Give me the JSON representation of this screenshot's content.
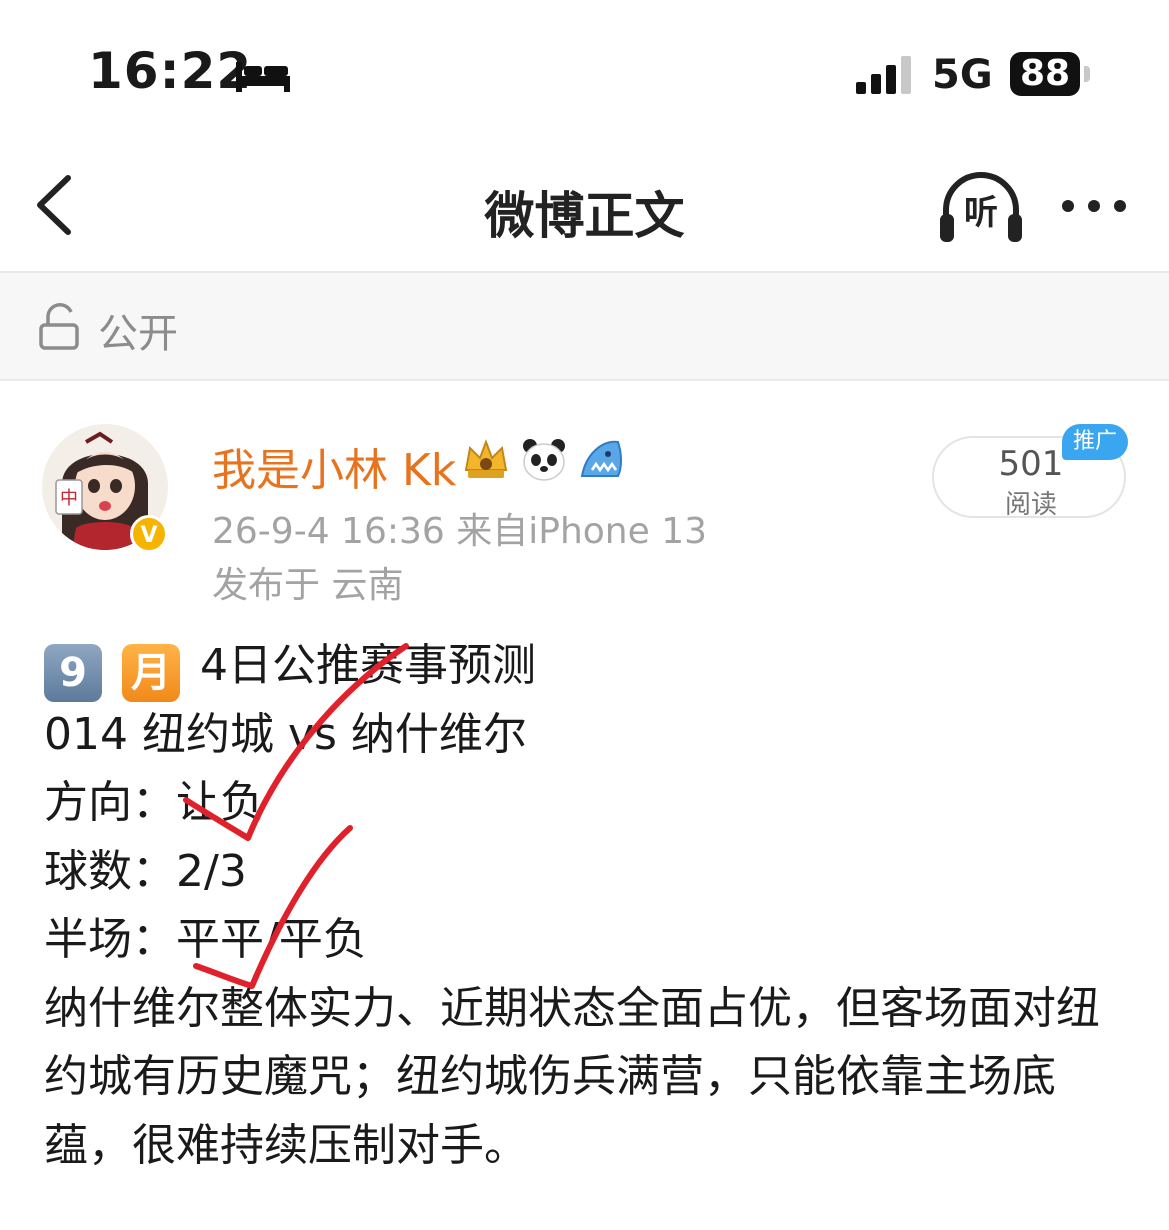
{
  "status_bar": {
    "time": "16:22",
    "network": "5G",
    "battery": "88"
  },
  "nav": {
    "title": "微博正文"
  },
  "visibility": {
    "label": "公开"
  },
  "author": {
    "name": "我是小林 Kk",
    "verified_badge": "V",
    "meta": "26-9-4 16:36  来自iPhone 13",
    "location": "发布于 云南"
  },
  "stats": {
    "read_count": "501",
    "read_label": "阅读",
    "promo_tag": "推广"
  },
  "post": {
    "title_keys": [
      "9",
      "月"
    ],
    "title_text": "4日公推赛事预测",
    "lines": [
      "014 纽约城 vs 纳什维尔",
      "方向：让负",
      "球数：2/3",
      "半场：平平/平负"
    ],
    "analysis": "纳什维尔整体实力、近期状态全面占优，但客场面对纽约城有历史魔咒；纽约城伤兵满营，只能依靠主场底蕴，很难持续压制对手。"
  },
  "colors": {
    "accent_name": "#e8731e",
    "meta": "#a3a3a3",
    "check_mark": "#e0202a",
    "promo": "#3ba6f0"
  }
}
